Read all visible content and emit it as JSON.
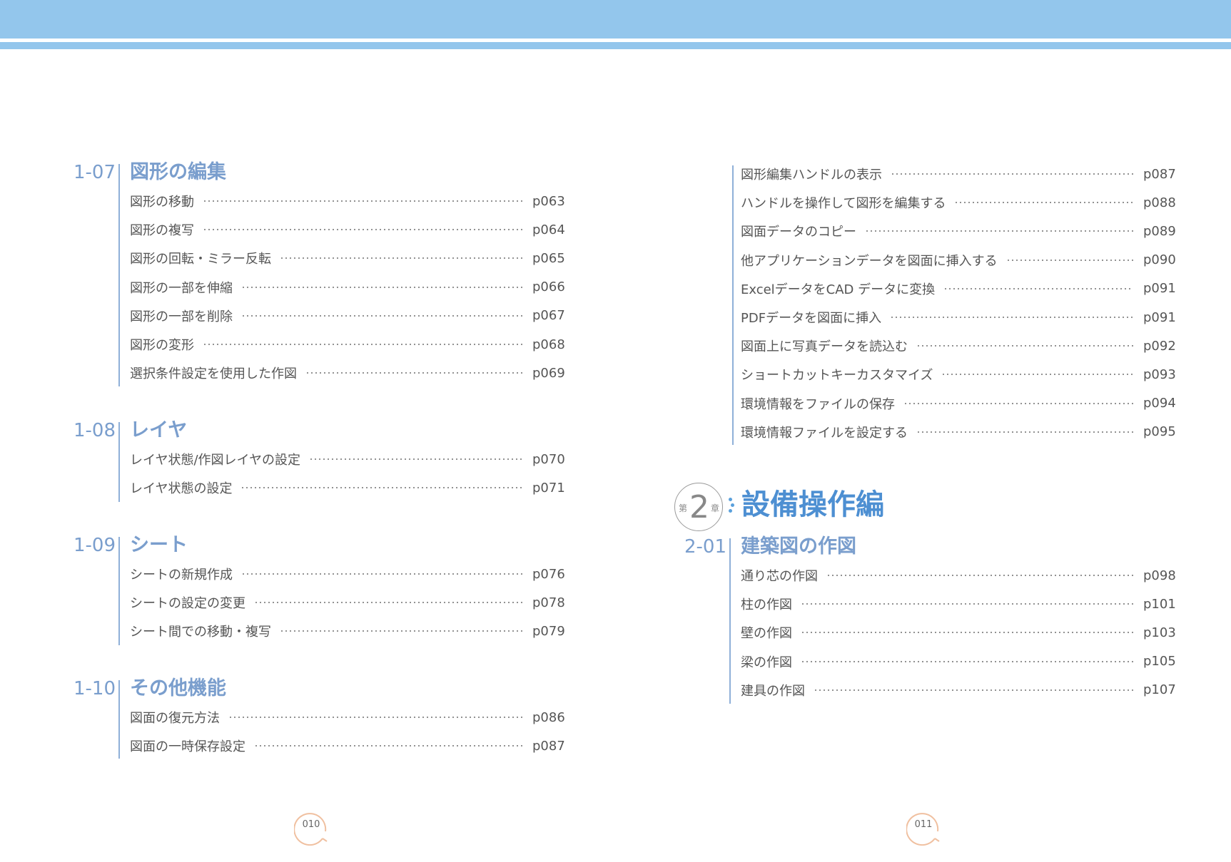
{
  "left_sections": [
    {
      "num": "1-07",
      "title": "図形の編集",
      "entries": [
        {
          "label": "図形の移動",
          "page": "p063"
        },
        {
          "label": "図形の複写",
          "page": "p064"
        },
        {
          "label": "図形の回転・ミラー反転",
          "page": "p065"
        },
        {
          "label": "図形の一部を伸縮",
          "page": "p066"
        },
        {
          "label": "図形の一部を削除",
          "page": "p067"
        },
        {
          "label": "図形の変形",
          "page": "p068"
        },
        {
          "label": "選択条件設定を使用した作図",
          "page": "p069"
        }
      ]
    },
    {
      "num": "1-08",
      "title": "レイヤ",
      "entries": [
        {
          "label": "レイヤ状態/作図レイヤの設定",
          "page": "p070"
        },
        {
          "label": "レイヤ状態の設定",
          "page": "p071"
        }
      ]
    },
    {
      "num": "1-09",
      "title": "シート",
      "entries": [
        {
          "label": "シートの新規作成",
          "page": "p076"
        },
        {
          "label": "シートの設定の変更",
          "page": "p078"
        },
        {
          "label": "シート間での移動・複写",
          "page": "p079"
        }
      ]
    },
    {
      "num": "1-10",
      "title": "その他機能",
      "entries": [
        {
          "label": "図面の復元方法",
          "page": "p086"
        },
        {
          "label": "図面の一時保存設定",
          "page": "p087"
        }
      ]
    }
  ],
  "right_continued": {
    "entries": [
      {
        "label": "図形編集ハンドルの表示",
        "page": "p087"
      },
      {
        "label": "ハンドルを操作して図形を編集する",
        "page": "p088"
      },
      {
        "label": "図面データのコピー",
        "page": "p089"
      },
      {
        "label": "他アプリケーションデータを図面に挿入する",
        "page": "p090"
      },
      {
        "label": "ExcelデータをCAD データに変換",
        "page": "p091"
      },
      {
        "label": "PDFデータを図面に挿入",
        "page": "p091"
      },
      {
        "label": "図面上に写真データを読込む",
        "page": "p092"
      },
      {
        "label": "ショートカットキーカスタマイズ",
        "page": "p093"
      },
      {
        "label": "環境情報をファイルの保存",
        "page": "p094"
      },
      {
        "label": "環境情報ファイルを設定する",
        "page": "p095"
      }
    ]
  },
  "chapter": {
    "prefix": "第",
    "number": "2",
    "suffix": "章",
    "title": "設備操作編"
  },
  "right_sections": [
    {
      "num": "2-01",
      "title": "建築図の作図",
      "entries": [
        {
          "label": "通り芯の作図",
          "page": "p098"
        },
        {
          "label": "柱の作図",
          "page": "p101"
        },
        {
          "label": "壁の作図",
          "page": "p103"
        },
        {
          "label": "梁の作図",
          "page": "p105"
        },
        {
          "label": "建具の作図",
          "page": "p107"
        }
      ]
    }
  ],
  "page_numbers": {
    "left": "010",
    "right": "011"
  },
  "colors": {
    "header_band": "#93c6ec",
    "section_title": "#7a9ecd",
    "chapter_title": "#4d8fd2",
    "page_mark": "#f0c0a0"
  }
}
